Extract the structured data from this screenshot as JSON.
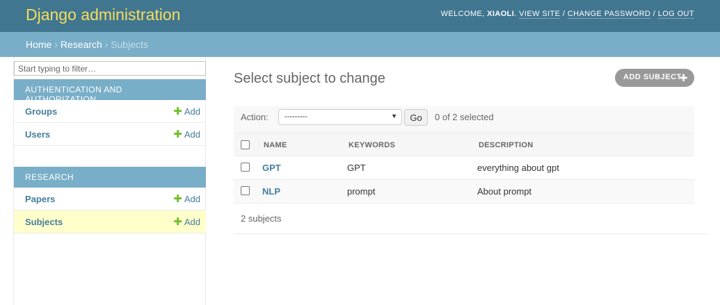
{
  "header": {
    "branding": "Django administration",
    "welcome": "Welcome,",
    "username": "XIAOLI",
    "view_site": "View site",
    "change_password": "Change password",
    "log_out": "Log out",
    "separator": "/"
  },
  "breadcrumbs": {
    "home": "Home",
    "app": "Research",
    "current": "Subjects",
    "separator": "›"
  },
  "sidebar": {
    "filter_placeholder": "Start typing to filter…",
    "modules": [
      {
        "caption": "Authentication and Authorization",
        "models": [
          {
            "name": "Groups",
            "add": "Add"
          },
          {
            "name": "Users",
            "add": "Add"
          }
        ]
      },
      {
        "caption": "Research",
        "models": [
          {
            "name": "Papers",
            "add": "Add"
          },
          {
            "name": "Subjects",
            "add": "Add"
          }
        ]
      }
    ]
  },
  "content": {
    "title": "Select subject to change",
    "add_button": "Add subject",
    "action_label": "Action:",
    "action_selected_value": "---------",
    "go_button": "Go",
    "selection_counter": "0 of 2 selected",
    "columns": [
      "Name",
      "Keywords",
      "Description"
    ],
    "rows": [
      {
        "name": "GPT",
        "keywords": "GPT",
        "description": "everything about gpt"
      },
      {
        "name": "NLP",
        "keywords": "prompt",
        "description": "About prompt"
      }
    ],
    "paginator": "2 subjects"
  },
  "colors": {
    "header_bg": "#417690",
    "branding": "#f5dd5d",
    "breadcrumb_bg": "#79aec8",
    "module_caption_bg": "#79aec8",
    "link": "#447e9b",
    "add_plus": "#70bf2b",
    "current_row_highlight": "#ffffcc",
    "add_button_bg": "#999999"
  },
  "icons": [
    "plus-icon",
    "add-circle-icon",
    "chevron-down-icon",
    "checkbox"
  ]
}
